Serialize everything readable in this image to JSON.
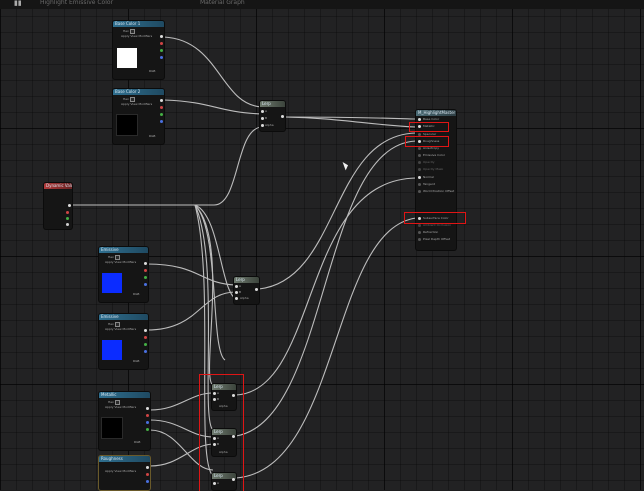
{
  "topbar": {
    "title": "Highlight Emissive Color",
    "crumb": "Material Graph"
  },
  "colors": {
    "highlight": "#e01515",
    "wire": "#d9d9d9"
  },
  "nodes": {
    "param1": {
      "title": "Base Color 1",
      "subtitle": "Param",
      "hex_label": "Hex",
      "row": "Apply View Modifiers",
      "out": "RGB",
      "swatch": "#ffffff"
    },
    "param2": {
      "title": "Base Color 2",
      "subtitle": "Param",
      "hex_label": "Hex",
      "row": "Apply View Modifiers",
      "out": "RGB",
      "swatch": "#000000"
    },
    "lerp1": {
      "title": "Lerp",
      "a": "A",
      "b": "B",
      "alpha": "Alpha"
    },
    "scalar": {
      "title": "Dynamic Value",
      "subtitle": "Param"
    },
    "param3": {
      "title": "Emissive",
      "subtitle": "Param",
      "hex_label": "Hex",
      "row": "Apply View Modifiers",
      "out": "RGB",
      "swatch": "#0b2cff"
    },
    "param4": {
      "title": "Emissive",
      "subtitle": "Param",
      "hex_label": "Hex",
      "row": "Apply View Modifiers",
      "out": "RGB",
      "swatch": "#0b2cff"
    },
    "lerp2": {
      "title": "Lerp",
      "a": "A",
      "b": "B",
      "alpha": "Alpha"
    },
    "param5": {
      "title": "Metallic",
      "subtitle": "Param",
      "hex_label": "Hex",
      "row": "Apply View Modifiers",
      "out": "RGB",
      "swatch": "#000000"
    },
    "param6": {
      "title": "Roughness",
      "subtitle": "Param",
      "row": "Apply View Modifiers"
    },
    "lerp3": {
      "title": "Lerp",
      "a": "A",
      "b": "B",
      "alpha": "Alpha"
    },
    "lerp4": {
      "title": "Lerp",
      "a": "A",
      "b": "B",
      "alpha": "Alpha"
    },
    "lerp5": {
      "title": "Lerp",
      "a": "A"
    },
    "material": {
      "title": "M_HighlightMaster",
      "pins": [
        "Base Color",
        "Metallic",
        "Specular",
        "Roughness",
        "Anisotropy",
        "Emissive Color",
        "Opacity",
        "Opacity Mask",
        "Normal",
        "Tangent",
        "World Position Offset",
        "Subsurface Color",
        "Ambient Occlusion",
        "Refraction",
        "Pixel Depth Offset"
      ]
    }
  }
}
